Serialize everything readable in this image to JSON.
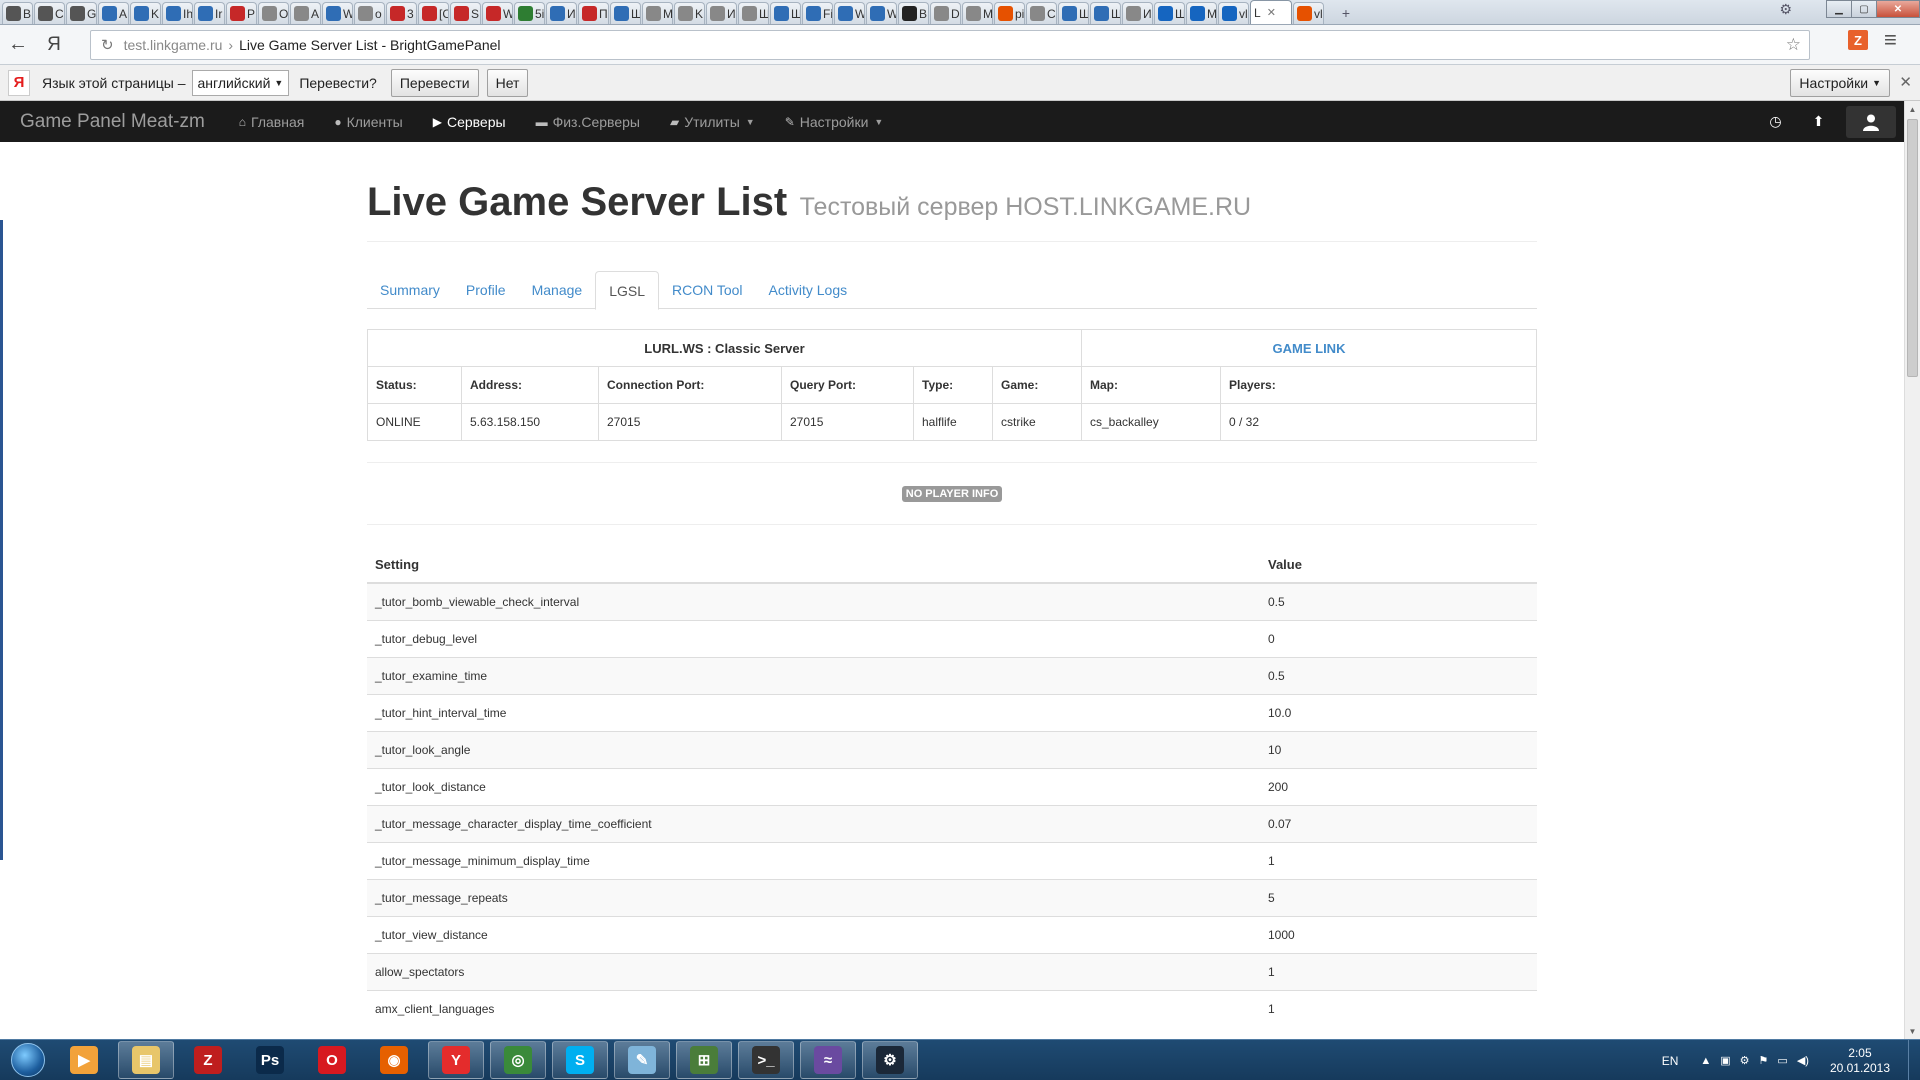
{
  "browser": {
    "tabs": [
      {
        "label": "B",
        "color": "#555555"
      },
      {
        "label": "C",
        "color": "#555555"
      },
      {
        "label": "G",
        "color": "#555555"
      },
      {
        "label": "A",
        "color": "#2f6db5"
      },
      {
        "label": "K",
        "color": "#2f6db5"
      },
      {
        "label": "Ih",
        "color": "#2f6db5"
      },
      {
        "label": "Ir",
        "color": "#2f6db5"
      },
      {
        "label": "P",
        "color": "#c62828"
      },
      {
        "label": "O",
        "color": "#888888"
      },
      {
        "label": "A",
        "color": "#888888"
      },
      {
        "label": "W",
        "color": "#2f6db5"
      },
      {
        "label": "o",
        "color": "#888888"
      },
      {
        "label": "3",
        "color": "#c62828"
      },
      {
        "label": "[C",
        "color": "#c62828"
      },
      {
        "label": "S",
        "color": "#c62828"
      },
      {
        "label": "W",
        "color": "#c62828"
      },
      {
        "label": "5i",
        "color": "#2e7d32"
      },
      {
        "label": "И",
        "color": "#2f6db5"
      },
      {
        "label": "П",
        "color": "#c62828"
      },
      {
        "label": "Ш",
        "color": "#2f6db5"
      },
      {
        "label": "M",
        "color": "#888888"
      },
      {
        "label": "K",
        "color": "#888888"
      },
      {
        "label": "И",
        "color": "#888888"
      },
      {
        "label": "Ш",
        "color": "#888888"
      },
      {
        "label": "Ш",
        "color": "#2f6db5"
      },
      {
        "label": "Fi",
        "color": "#2f6db5"
      },
      {
        "label": "W",
        "color": "#2f6db5"
      },
      {
        "label": "W",
        "color": "#2f6db5"
      },
      {
        "label": "B",
        "color": "#222222"
      },
      {
        "label": "D",
        "color": "#888888"
      },
      {
        "label": "M",
        "color": "#888888"
      },
      {
        "label": "pi",
        "color": "#e65100"
      },
      {
        "label": "C",
        "color": "#888888"
      },
      {
        "label": "Ш",
        "color": "#2f6db5"
      },
      {
        "label": "Ш",
        "color": "#2f6db5"
      },
      {
        "label": "И",
        "color": "#888888"
      },
      {
        "label": "Ш",
        "color": "#1565c0"
      },
      {
        "label": "M",
        "color": "#1565c0"
      },
      {
        "label": "vl",
        "color": "#1565c0"
      }
    ],
    "active_tab": {
      "label": "L"
    },
    "extra_tab": {
      "label": "vl",
      "color": "#e65100"
    },
    "url_host": "test.linkgame.ru",
    "url_sep": "›",
    "page_title": "Live Game Server List - BrightGamePanel",
    "ext_z_label": "Z",
    "back_label": "←",
    "yandex_label": "Я"
  },
  "translate_bar": {
    "logo": "Я",
    "text": "Язык этой страницы –",
    "language": "английский",
    "question": "Перевести?",
    "translate_button": "Перевести",
    "no_button": "Нет",
    "settings_button": "Настройки"
  },
  "navbar": {
    "brand": "Game Panel Meat-zm",
    "items": [
      {
        "label": "Главная",
        "icon": "home-icon"
      },
      {
        "label": "Клиенты",
        "icon": "user-icon"
      },
      {
        "label": "Серверы",
        "icon": "play-icon",
        "active": true
      },
      {
        "label": "Физ.Серверы",
        "icon": "hdd-icon"
      },
      {
        "label": "Утилиты",
        "icon": "briefcase-icon",
        "dropdown": true
      },
      {
        "label": "Настройки",
        "icon": "wrench-icon",
        "dropdown": true
      }
    ]
  },
  "page": {
    "title": "Live Game Server List",
    "subtitle": "Тестовый сервер HOST.LINKGAME.RU",
    "tabs": [
      "Summary",
      "Profile",
      "Manage",
      "LGSL",
      "RCON Tool",
      "Activity Logs"
    ],
    "active_tab": "LGSL"
  },
  "server": {
    "name": "LURL.WS : Classic Server",
    "game_link": "GAME LINK",
    "headers": [
      "Status:",
      "Address:",
      "Connection Port:",
      "Query Port:",
      "Type:",
      "Game:",
      "Map:",
      "Players:"
    ],
    "values": [
      "ONLINE",
      "5.63.158.150",
      "27015",
      "27015",
      "halflife",
      "cstrike",
      "cs_backalley",
      "0 / 32"
    ]
  },
  "no_player_info": "NO PLAYER INFO",
  "settings": {
    "header_setting": "Setting",
    "header_value": "Value",
    "rows": [
      {
        "setting": "_tutor_bomb_viewable_check_interval",
        "value": "0.5"
      },
      {
        "setting": "_tutor_debug_level",
        "value": "0"
      },
      {
        "setting": "_tutor_examine_time",
        "value": "0.5"
      },
      {
        "setting": "_tutor_hint_interval_time",
        "value": "10.0"
      },
      {
        "setting": "_tutor_look_angle",
        "value": "10"
      },
      {
        "setting": "_tutor_look_distance",
        "value": "200"
      },
      {
        "setting": "_tutor_message_character_display_time_coefficient",
        "value": "0.07"
      },
      {
        "setting": "_tutor_message_minimum_display_time",
        "value": "1"
      },
      {
        "setting": "_tutor_message_repeats",
        "value": "5"
      },
      {
        "setting": "_tutor_view_distance",
        "value": "1000"
      },
      {
        "setting": "allow_spectators",
        "value": "1"
      },
      {
        "setting": "amx_client_languages",
        "value": "1"
      }
    ]
  },
  "taskbar": {
    "apps": [
      {
        "name": "media-player-icon",
        "glyph": "▶",
        "color": "#f2a23a",
        "open": false
      },
      {
        "name": "explorer-icon",
        "glyph": "▤",
        "color": "#e8c66a",
        "open": true
      },
      {
        "name": "filezilla-icon",
        "glyph": "Z",
        "color": "#bf1e1e",
        "open": false
      },
      {
        "name": "photoshop-icon",
        "glyph": "Ps",
        "color": "#0b2a4a",
        "open": false
      },
      {
        "name": "opera-icon",
        "glyph": "O",
        "color": "#d71920",
        "open": false
      },
      {
        "name": "firefox-icon",
        "glyph": "◉",
        "color": "#e66000",
        "open": false
      },
      {
        "name": "yandex-browser-icon",
        "glyph": "Y",
        "color": "#e42c2c",
        "open": true
      },
      {
        "name": "chrome-icon",
        "glyph": "◎",
        "color": "#3a8a3a",
        "open": true
      },
      {
        "name": "skype-icon",
        "glyph": "S",
        "color": "#00aff0",
        "open": true
      },
      {
        "name": "notepad-icon",
        "glyph": "✎",
        "color": "#7fb4d9",
        "open": true
      },
      {
        "name": "network-icon",
        "glyph": "⊞",
        "color": "#4a7d3a",
        "open": true
      },
      {
        "name": "terminal-icon",
        "glyph": ">_",
        "color": "#333333",
        "open": true
      },
      {
        "name": "winamp-icon",
        "glyph": "≈",
        "color": "#6a4aa0",
        "open": true
      },
      {
        "name": "steam-icon",
        "glyph": "⚙",
        "color": "#1b2838",
        "open": true
      }
    ],
    "lang": "EN",
    "time": "2:05",
    "date": "20.01.2013"
  }
}
